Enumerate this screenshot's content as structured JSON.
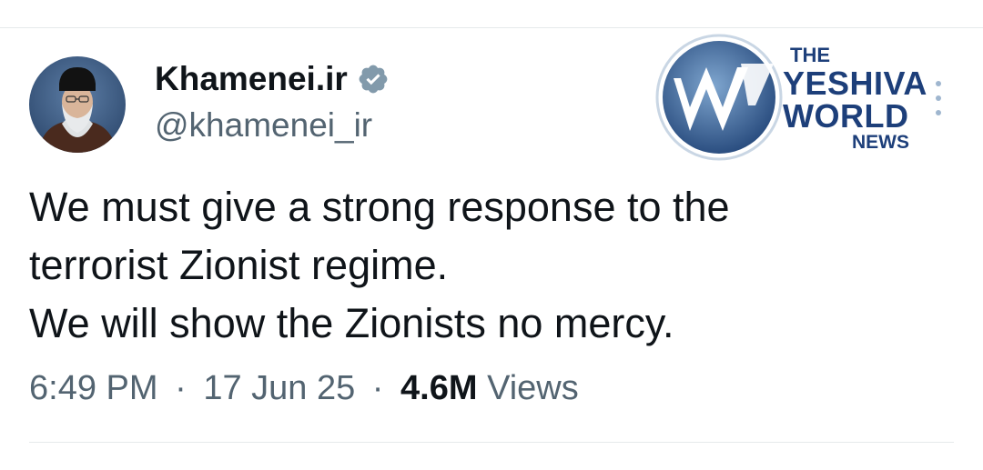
{
  "tweet": {
    "display_name": "Khamenei.ir",
    "handle": "@khamenei_ir",
    "verified_icon": "verified-badge-icon",
    "lines": [
      "We must give a strong response to the",
      "terrorist Zionist regime.",
      "We will show the Zionists no mercy."
    ],
    "time": "6:49 PM",
    "date": "17 Jun 25",
    "separator": "·",
    "views_count": "4.6M",
    "views_label": "Views"
  },
  "watermark": {
    "line1": "THE",
    "line2": "YESHIVA",
    "line3": "WORLD",
    "line4": "NEWS",
    "logo_letter": "W"
  },
  "colors": {
    "text_primary": "#0f1419",
    "text_secondary": "#536471",
    "verified_gray": "#829aab",
    "watermark_blue": "#1d3f7a"
  }
}
